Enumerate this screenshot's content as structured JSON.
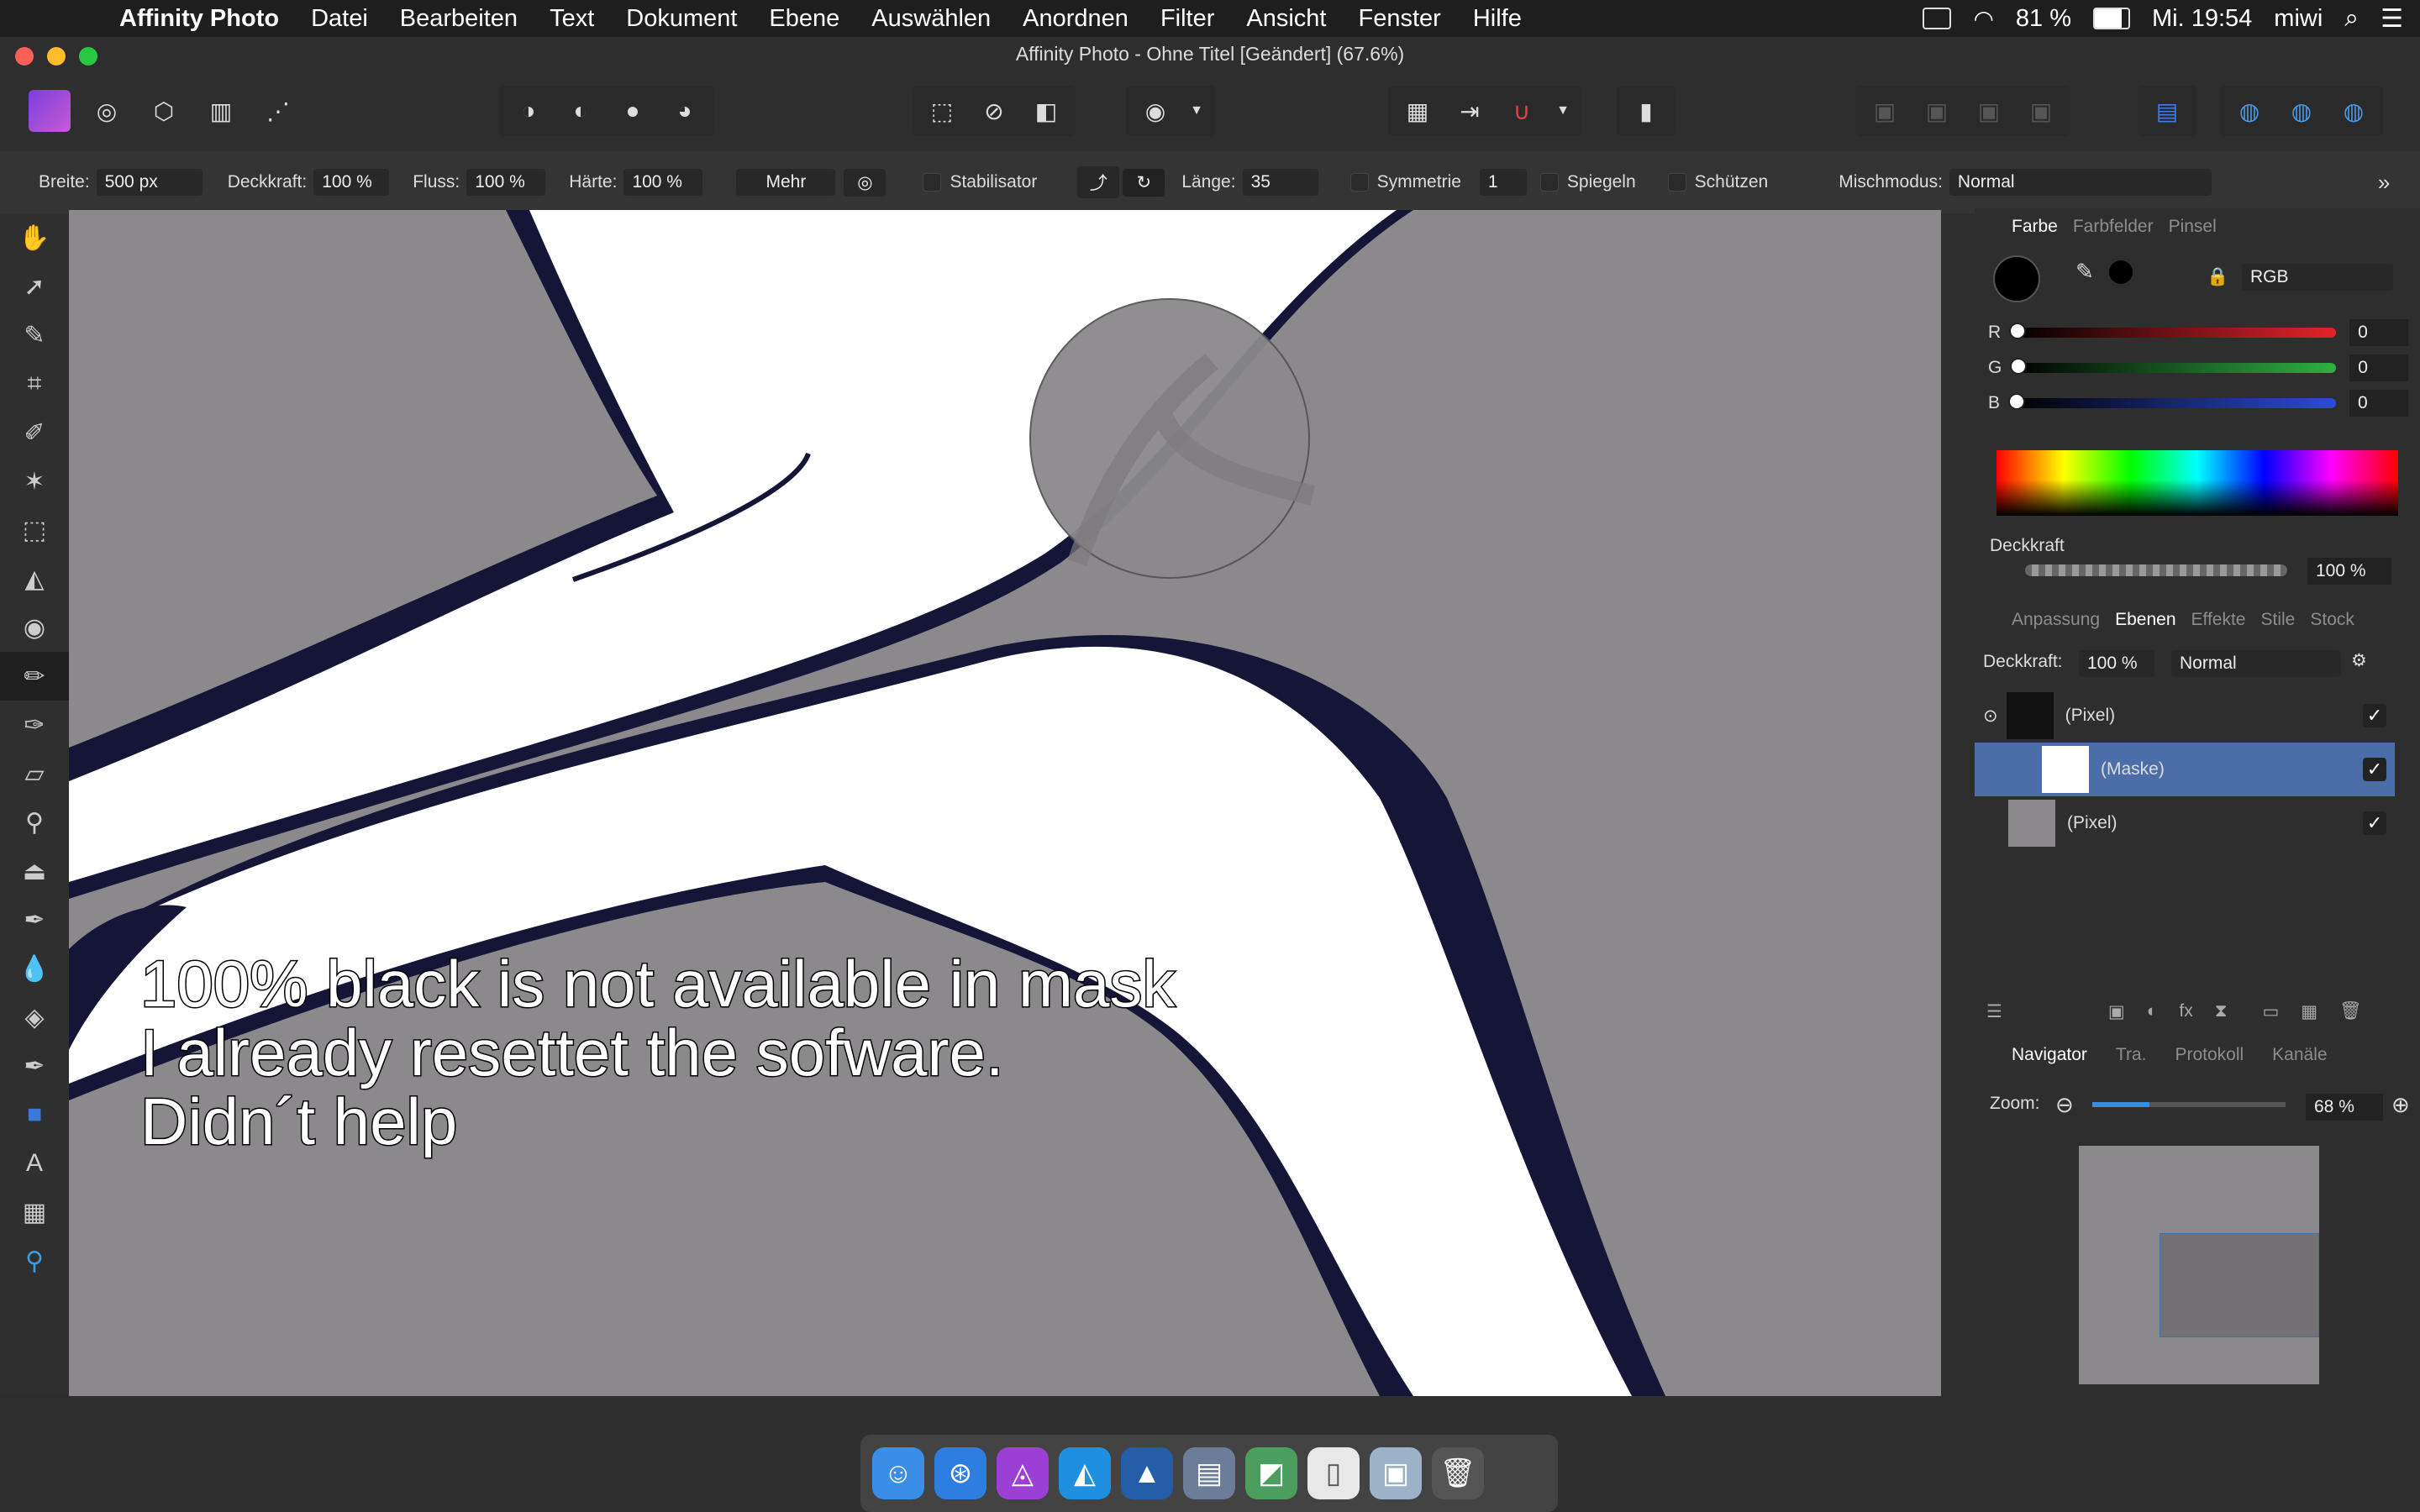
{
  "menubar": {
    "app": "Affinity Photo",
    "items": [
      "Datei",
      "Bearbeiten",
      "Text",
      "Dokument",
      "Ebene",
      "Auswählen",
      "Anordnen",
      "Filter",
      "Ansicht",
      "Fenster",
      "Hilfe"
    ],
    "battery": "81 %",
    "clock": "Mi. 19:54",
    "user": "miwi"
  },
  "window": {
    "title": "Affinity Photo - Ohne Titel [Geändert] (67.6%)"
  },
  "context": {
    "breite_label": "Breite:",
    "breite": "500 px",
    "deckkraft_label": "Deckkraft:",
    "deckkraft": "100 %",
    "fluss_label": "Fluss:",
    "fluss": "100 %",
    "haerte_label": "Härte:",
    "haerte": "100 %",
    "mehr": "Mehr",
    "stabilisator": "Stabilisator",
    "laenge_label": "Länge:",
    "laenge": "35",
    "symmetrie": "Symmetrie",
    "sym_count": "1",
    "spiegeln": "Spiegeln",
    "schuetzen": "Schützen",
    "mischmodus_label": "Mischmodus:",
    "mischmodus": "Normal"
  },
  "canvas": {
    "overlay_lines": [
      "100% black is not available in mask",
      "I already resettet the sofware.",
      "Didn´t help"
    ]
  },
  "color_panel": {
    "tabs": [
      "Farbe",
      "Farbfelder",
      "Pinsel"
    ],
    "model": "RGB",
    "r_label": "R",
    "g_label": "G",
    "b_label": "B",
    "r": "0",
    "g": "0",
    "b": "0",
    "opacity_label": "Deckkraft",
    "opacity": "100 %"
  },
  "layers_panel": {
    "tabs": [
      "Anpassung",
      "Ebenen",
      "Effekte",
      "Stile",
      "Stock"
    ],
    "opacity_label": "Deckkraft:",
    "opacity": "100 %",
    "blend": "Normal",
    "layers": [
      {
        "name": "(Pixel)"
      },
      {
        "name": "(Maske)"
      },
      {
        "name": "(Pixel)"
      }
    ]
  },
  "navigator_panel": {
    "tabs": [
      "Navigator",
      "Tra.",
      "Protokoll",
      "Kanäle"
    ],
    "zoom_label": "Zoom:",
    "zoom": "68 %"
  },
  "colors": {
    "accent": "#4c6ea8",
    "bird_outline": "#141537",
    "canvas_bg": "#8b898b"
  }
}
